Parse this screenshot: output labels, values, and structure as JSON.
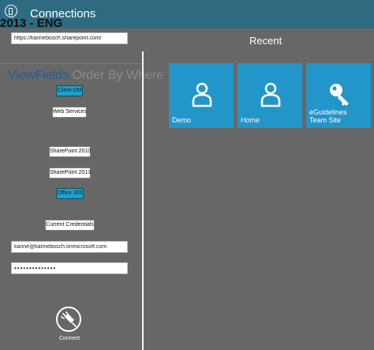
{
  "header": {
    "title": "Connections",
    "ghost_version": "2013 - ENG"
  },
  "connection": {
    "url": "https://karinebosch.sharepoint.com/",
    "ghost_tabs": {
      "viewfields": "ViewFields",
      "rest": " Order By Where"
    },
    "api_options": {
      "client_om": "Client OM",
      "web_services": "Web Services"
    },
    "versions": {
      "sp2010": "SharePoint 2010",
      "sp2013": "SharePoint 2013",
      "office365": "Office 365"
    },
    "credentials": {
      "current_credentials_label": "Current Credentials",
      "username": "karine@karinebosch.onmicrosoft.com",
      "password": "••••••••••••••"
    },
    "connect_label": "Connect"
  },
  "recent": {
    "title": "Recent",
    "tiles": [
      {
        "label": "Demo",
        "icon": "user-icon"
      },
      {
        "label": "Home",
        "icon": "user-icon"
      },
      {
        "label": "eGuidelines\nTeam Site",
        "label_line1": "eGuidelines",
        "label_line2": "Team Site",
        "icon": "key-icon"
      }
    ]
  },
  "colors": {
    "background": "#676767",
    "accent": "#2295c9",
    "active_button": "#1f9fc9",
    "header": "#2e6b80"
  }
}
